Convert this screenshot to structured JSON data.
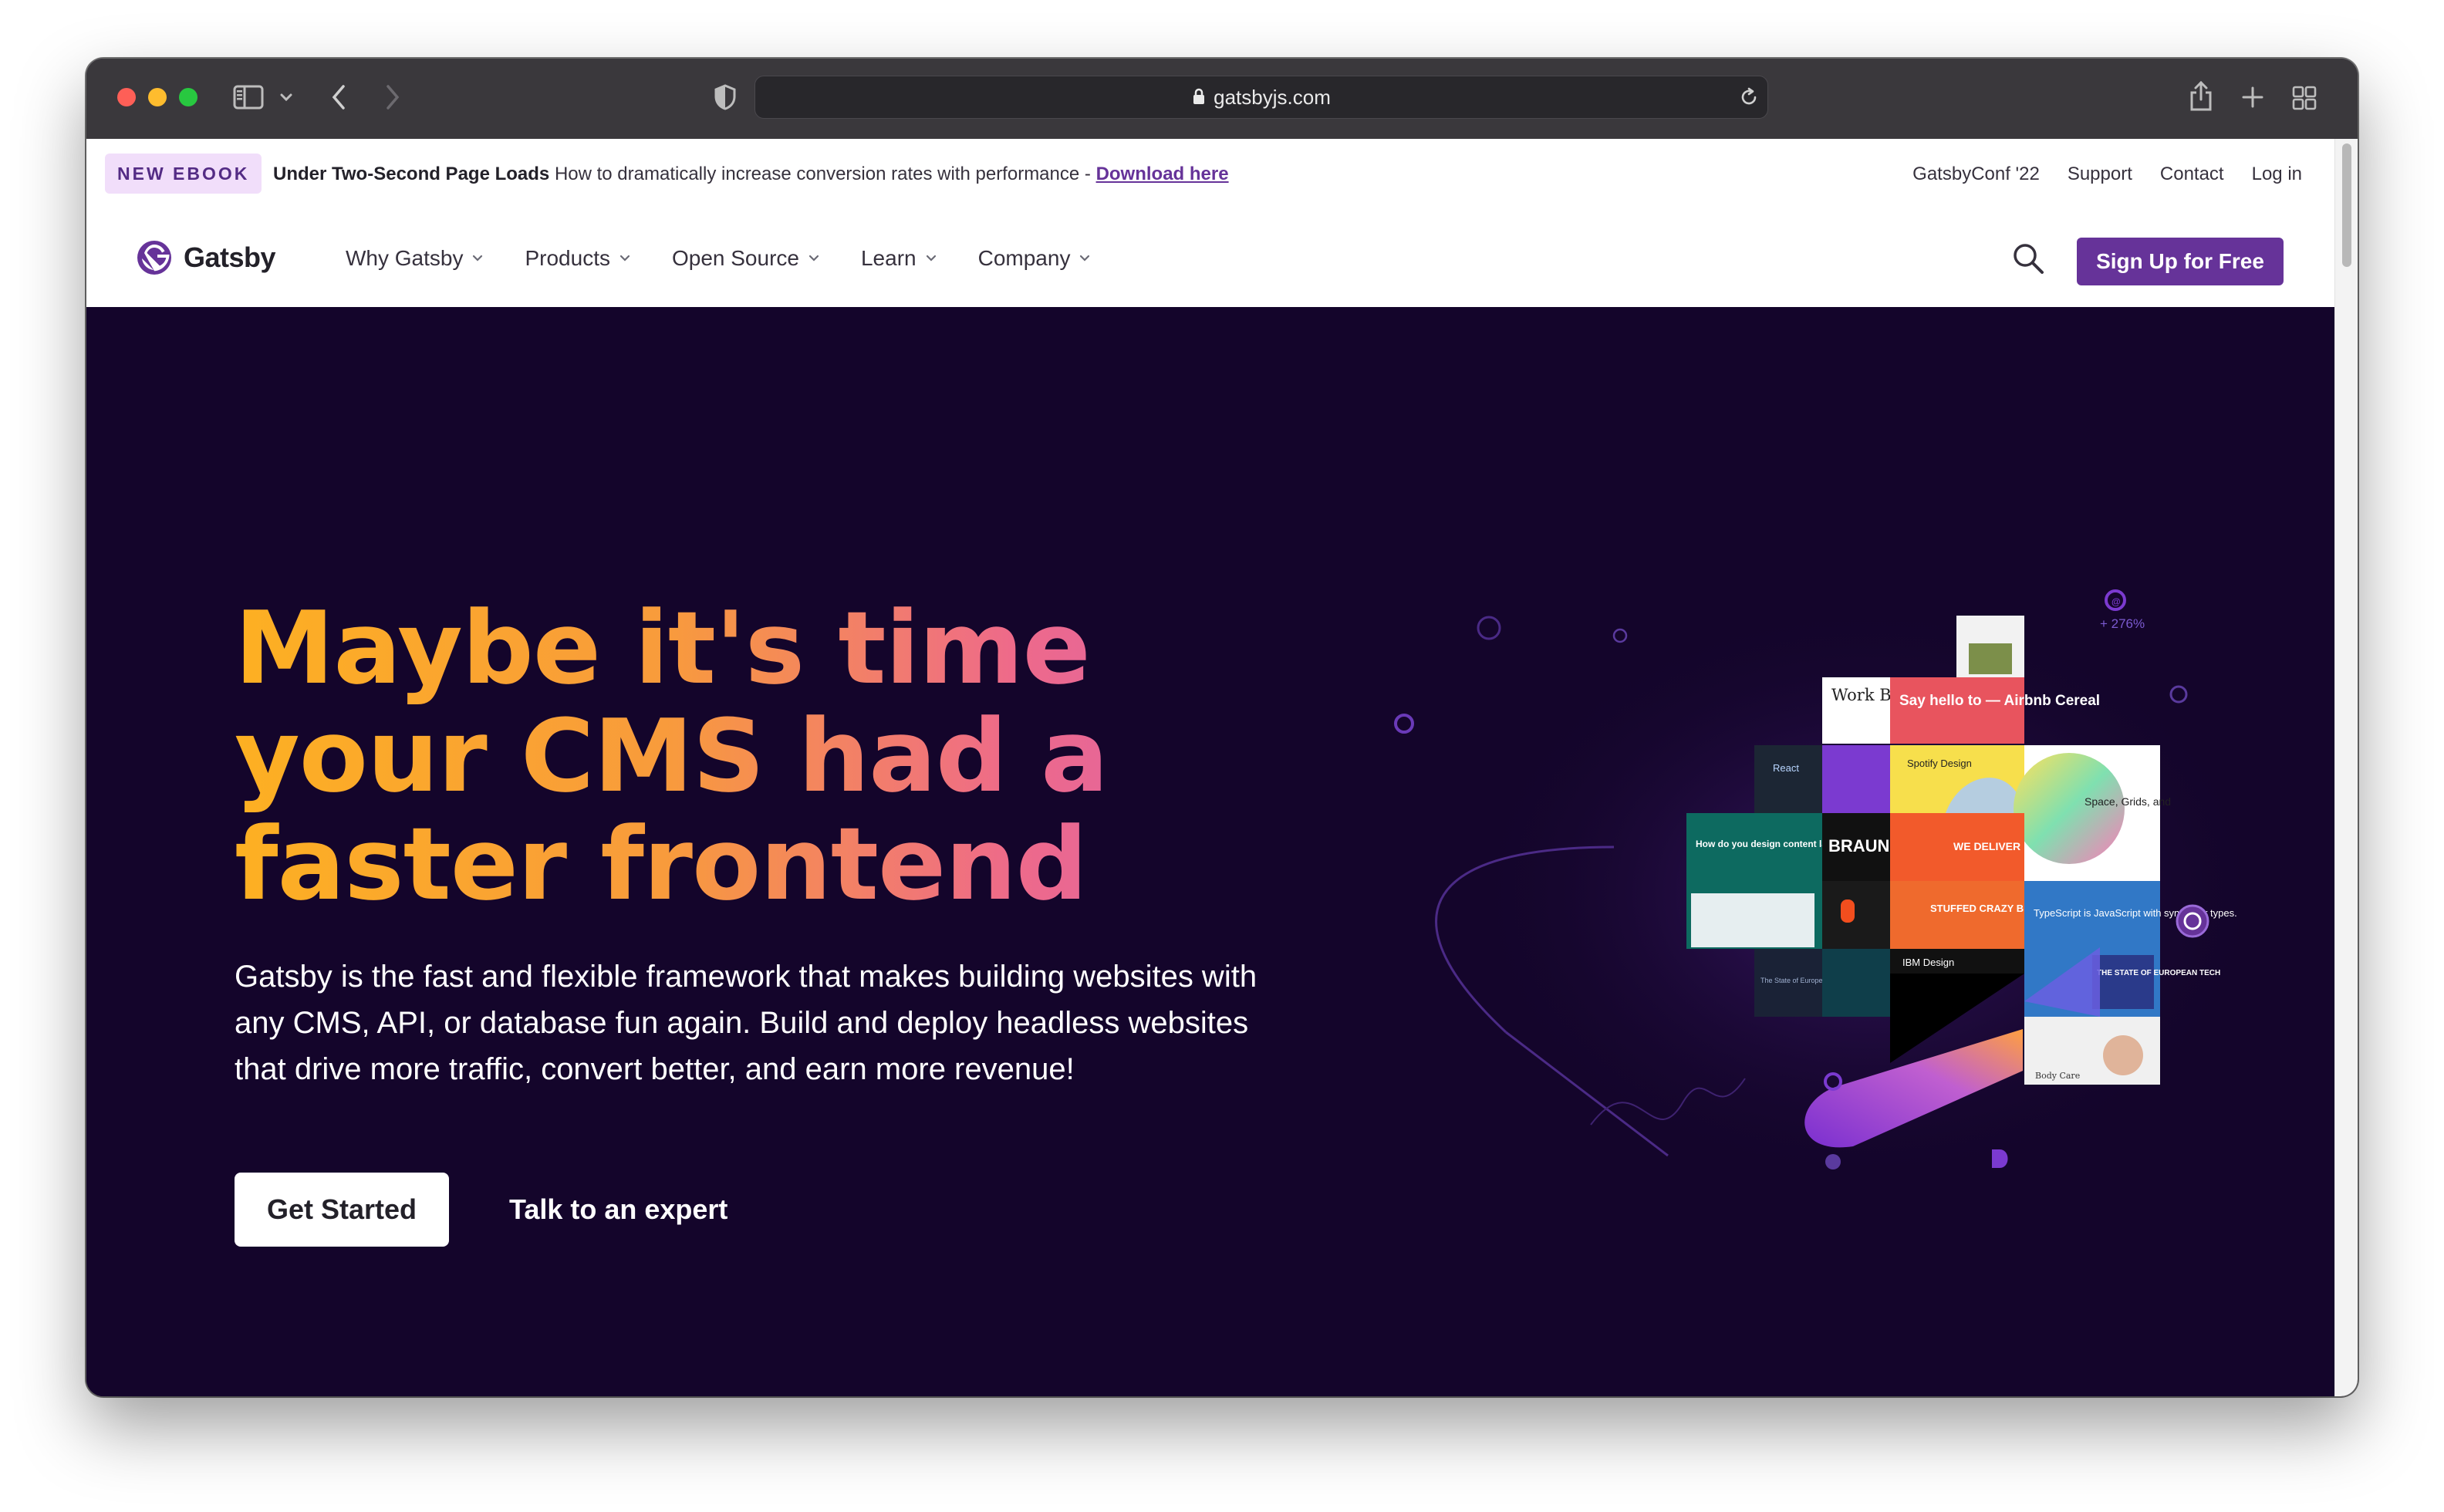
{
  "browser": {
    "url": "gatsbyjs.com"
  },
  "banner": {
    "badge": "NEW EBOOK",
    "headline": "Under Two-Second Page Loads",
    "message": "How to dramatically increase conversion rates with performance -",
    "link": "Download here",
    "links": [
      "GatsbyConf '22",
      "Support",
      "Contact",
      "Log in"
    ]
  },
  "nav": {
    "logo": "Gatsby",
    "items": [
      "Why Gatsby",
      "Products",
      "Open Source",
      "Learn",
      "Company"
    ],
    "signup": "Sign Up for Free"
  },
  "hero": {
    "headline": "Maybe it's time your CMS had a faster frontend",
    "description": "Gatsby is the fast and flexible framework that makes building websites with any CMS, API, or database fun again. Build and deploy headless websites that drive more traffic, convert better, and earn more revenue!",
    "primary_cta": "Get Started",
    "secondary_cta": "Talk to an expert"
  },
  "illustration": {
    "stat": "+ 276%",
    "tiles": [
      "Work Blog Tools",
      "Say hello to — Airbnb Cereal",
      "Spotify Design",
      "React",
      "How do you design content language?",
      "BRAUN",
      "WE DELIVER",
      "STUFFED CRAZY BREAD",
      "IBM Design",
      "Space, Grids, and",
      "TypeScript is JavaScript with syntax for types.",
      "THE STATE OF EUROPEAN TECH",
      "The State of European Tech",
      "Body Care"
    ]
  },
  "colors": {
    "brand_purple": "#663399",
    "hero_background": "#14052b",
    "headline_gradient_start": "#fdb022",
    "headline_gradient_end": "#d85fb0"
  }
}
